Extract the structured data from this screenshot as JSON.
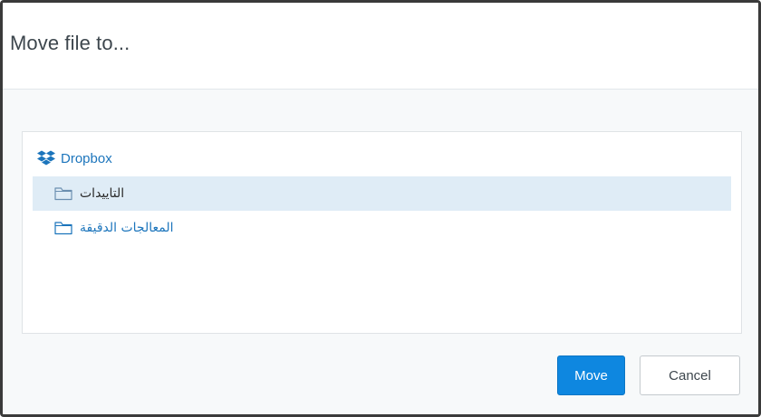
{
  "dialog": {
    "title": "Move file to..."
  },
  "tree": {
    "root": {
      "label": "Dropbox",
      "icon": "dropbox-icon"
    },
    "items": [
      {
        "label": "التاييدات",
        "icon": "folder-icon",
        "selected": true
      },
      {
        "label": "المعالجات الدقيقة",
        "icon": "folder-icon",
        "selected": false
      }
    ]
  },
  "footer": {
    "move_label": "Move",
    "cancel_label": "Cancel"
  },
  "colors": {
    "accent": "#0e87e0",
    "link": "#1c75bc",
    "selection": "#dfecf6",
    "body_background": "#f7f9fa",
    "border": "#3a3a3a"
  }
}
